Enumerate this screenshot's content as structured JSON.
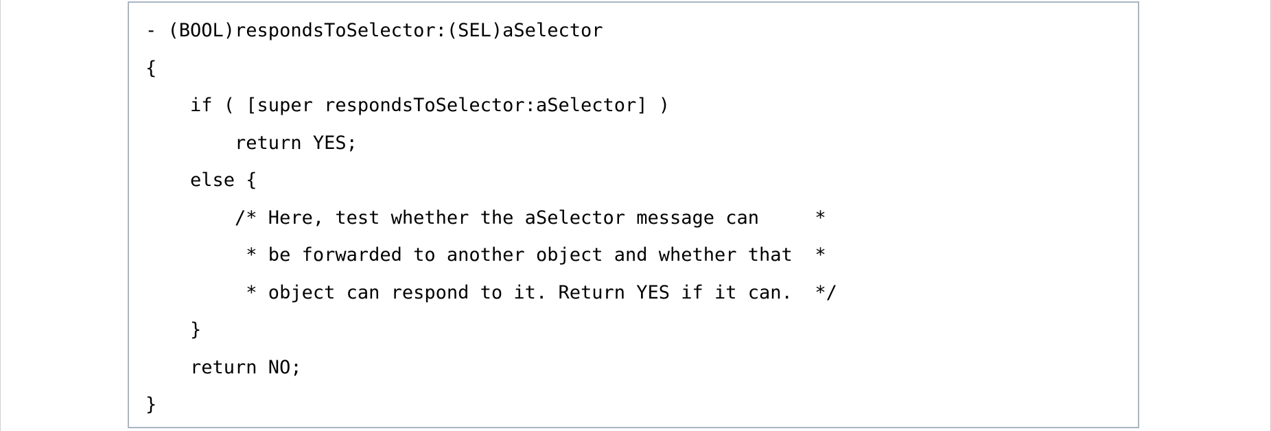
{
  "code": {
    "lines": [
      "- (BOOL)respondsToSelector:(SEL)aSelector",
      "{",
      "    if ( [super respondsToSelector:aSelector] )",
      "        return YES;",
      "    else {",
      "        /* Here, test whether the aSelector message can     *",
      "         * be forwarded to another object and whether that  *",
      "         * object can respond to it. Return YES if it can.  */",
      "    }",
      "    return NO;",
      "}"
    ]
  },
  "colors": {
    "border": "#a8b6c3",
    "text": "#000000",
    "background": "#ffffff"
  }
}
